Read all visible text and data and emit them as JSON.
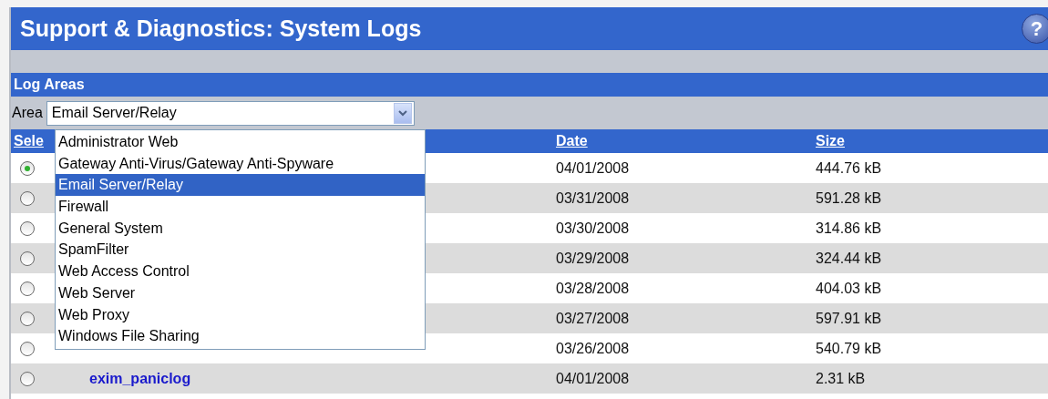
{
  "header": {
    "title": "Support & Diagnostics: System Logs",
    "help_icon": "?"
  },
  "section": {
    "title": "Log Areas"
  },
  "area": {
    "label": "Area",
    "value": "Email Server/Relay",
    "expanded": true,
    "options": [
      {
        "label": "Administrator Web",
        "selected": false
      },
      {
        "label": "Gateway Anti-Virus/Gateway Anti-Spyware",
        "selected": false
      },
      {
        "label": "Email Server/Relay",
        "selected": true
      },
      {
        "label": "Firewall",
        "selected": false
      },
      {
        "label": "General System",
        "selected": false
      },
      {
        "label": "SpamFilter",
        "selected": false
      },
      {
        "label": "Web Access Control",
        "selected": false
      },
      {
        "label": "Web Server",
        "selected": false
      },
      {
        "label": "Web Proxy",
        "selected": false
      },
      {
        "label": "Windows File Sharing",
        "selected": false
      }
    ]
  },
  "table": {
    "columns": [
      "Sele",
      "Date",
      "Size"
    ],
    "rows": [
      {
        "selected": true,
        "date": "04/01/2008",
        "size": "444.76 kB"
      },
      {
        "selected": false,
        "date": "03/31/2008",
        "size": "591.28 kB"
      },
      {
        "selected": false,
        "date": "03/30/2008",
        "size": "314.86 kB"
      },
      {
        "selected": false,
        "date": "03/29/2008",
        "size": "324.44 kB"
      },
      {
        "selected": false,
        "date": "03/28/2008",
        "size": "404.03 kB"
      },
      {
        "selected": false,
        "date": "03/27/2008",
        "size": "597.91 kB"
      },
      {
        "selected": false,
        "date": "03/26/2008",
        "size": "540.79 kB"
      },
      {
        "selected": false,
        "name": "exim_paniclog",
        "date": "04/01/2008",
        "size": "2.31 kB"
      }
    ]
  }
}
